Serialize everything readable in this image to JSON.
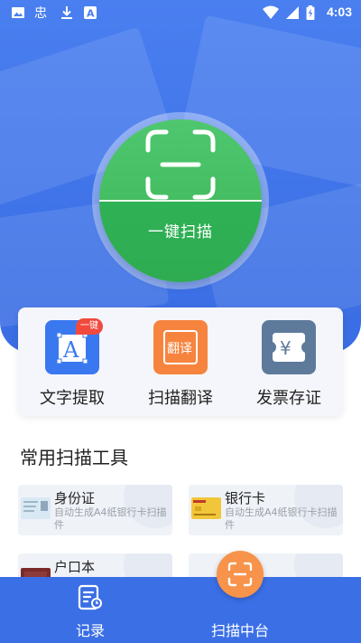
{
  "status_bar": {
    "time": "4:03",
    "left_icons": [
      "image-icon",
      "bug-icon",
      "download-icon",
      "font-a-icon"
    ],
    "right_icons": [
      "wifi-icon",
      "signal-icon",
      "battery-icon"
    ]
  },
  "hero": {
    "scan_button_label": "一键扫描",
    "accent_color": "#3f73e8",
    "scan_color": "#45bd62"
  },
  "features": [
    {
      "label": "文字提取",
      "icon": "text-extract-icon",
      "badge": "一键",
      "color": "#3a78f0"
    },
    {
      "label": "扫描翻译",
      "icon": "translate-icon",
      "icon_text": "翻译",
      "color": "#f6843f"
    },
    {
      "label": "发票存证",
      "icon": "invoice-icon",
      "color": "#5e7a9b"
    }
  ],
  "section": {
    "title": "常用扫描工具"
  },
  "tools": [
    {
      "title": "身份证",
      "desc": "自动生成A4纸银行卡扫描件",
      "icon": "id-card-thumb"
    },
    {
      "title": "银行卡",
      "desc": "自动生成A4纸银行卡扫描件",
      "icon": "bank-card-thumb"
    },
    {
      "title": "户口本",
      "desc": "",
      "icon": "household-register-thumb"
    },
    {
      "title": "",
      "desc": "",
      "icon": "tool-thumb"
    }
  ],
  "bottom_nav": {
    "items": [
      {
        "label": "记录",
        "icon": "record-icon"
      },
      {
        "label": "扫描中台",
        "icon": "scan-icon"
      }
    ]
  }
}
